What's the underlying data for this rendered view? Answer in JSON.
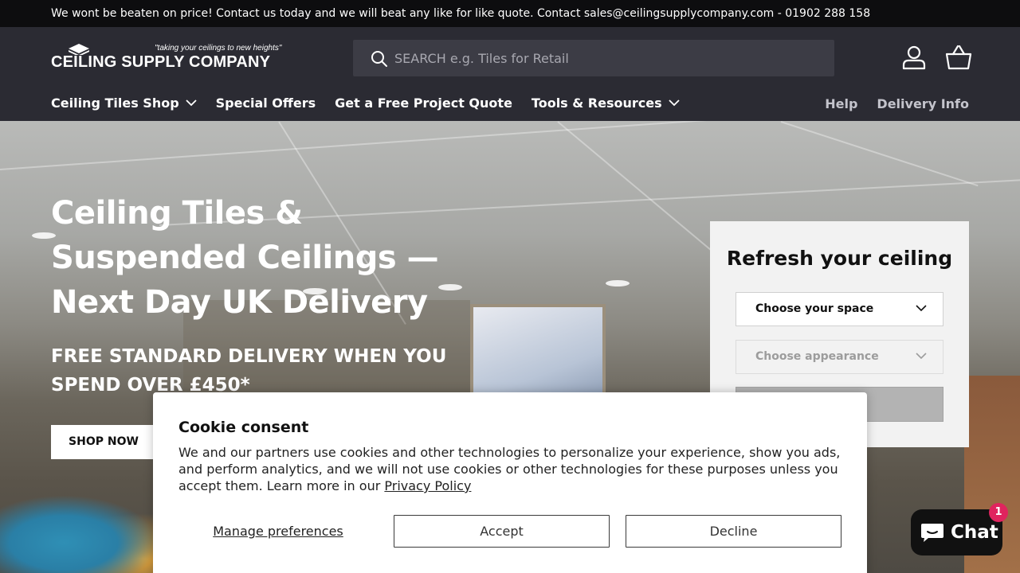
{
  "announcement": "We wont be beaten on price! Contact us today and we will beat any like for like quote. Contact sales@ceilingsupplycompany.com - 01902 288 158",
  "header": {
    "logo_tagline": "\"taking your ceilings to new heights\"",
    "logo_name": "CEILING SUPPLY COMPANY",
    "search_placeholder": "SEARCH e.g. Tiles for Retail",
    "account_icon": "user-icon",
    "cart_icon": "basket-icon"
  },
  "nav": {
    "items": [
      {
        "label": "Ceiling Tiles Shop",
        "dropdown": true
      },
      {
        "label": "Special Offers",
        "dropdown": false
      },
      {
        "label": "Get a Free Project Quote",
        "dropdown": false
      },
      {
        "label": "Tools & Resources",
        "dropdown": true
      }
    ],
    "right": [
      {
        "label": "Help"
      },
      {
        "label": "Delivery Info"
      }
    ]
  },
  "hero": {
    "title": "Ceiling Tiles & Suspended Ceilings — Next Day UK Delivery",
    "subtitle": "FREE STANDARD DELIVERY WHEN YOU SPEND OVER £450*",
    "cta": "SHOP NOW"
  },
  "refresh": {
    "title": "Refresh your ceiling",
    "space_select": "Choose your space",
    "appearance_select": "Choose appearance"
  },
  "cookie": {
    "title": "Cookie consent",
    "body": "We and our partners use cookies and other technologies to personalize your experience, show you ads, and perform analytics, and we will not use cookies or other technologies for these purposes unless you accept them. Learn more in our ",
    "privacy_link": "Privacy Policy",
    "manage": "Manage preferences",
    "accept": "Accept",
    "decline": "Decline"
  },
  "chat": {
    "label": "Chat",
    "badge": "1"
  },
  "colors": {
    "announcement_bg": "#0d0d0f",
    "header_bg": "#2b2b33",
    "search_bg": "#3c3c45",
    "chat_badge": "#e0245e"
  }
}
